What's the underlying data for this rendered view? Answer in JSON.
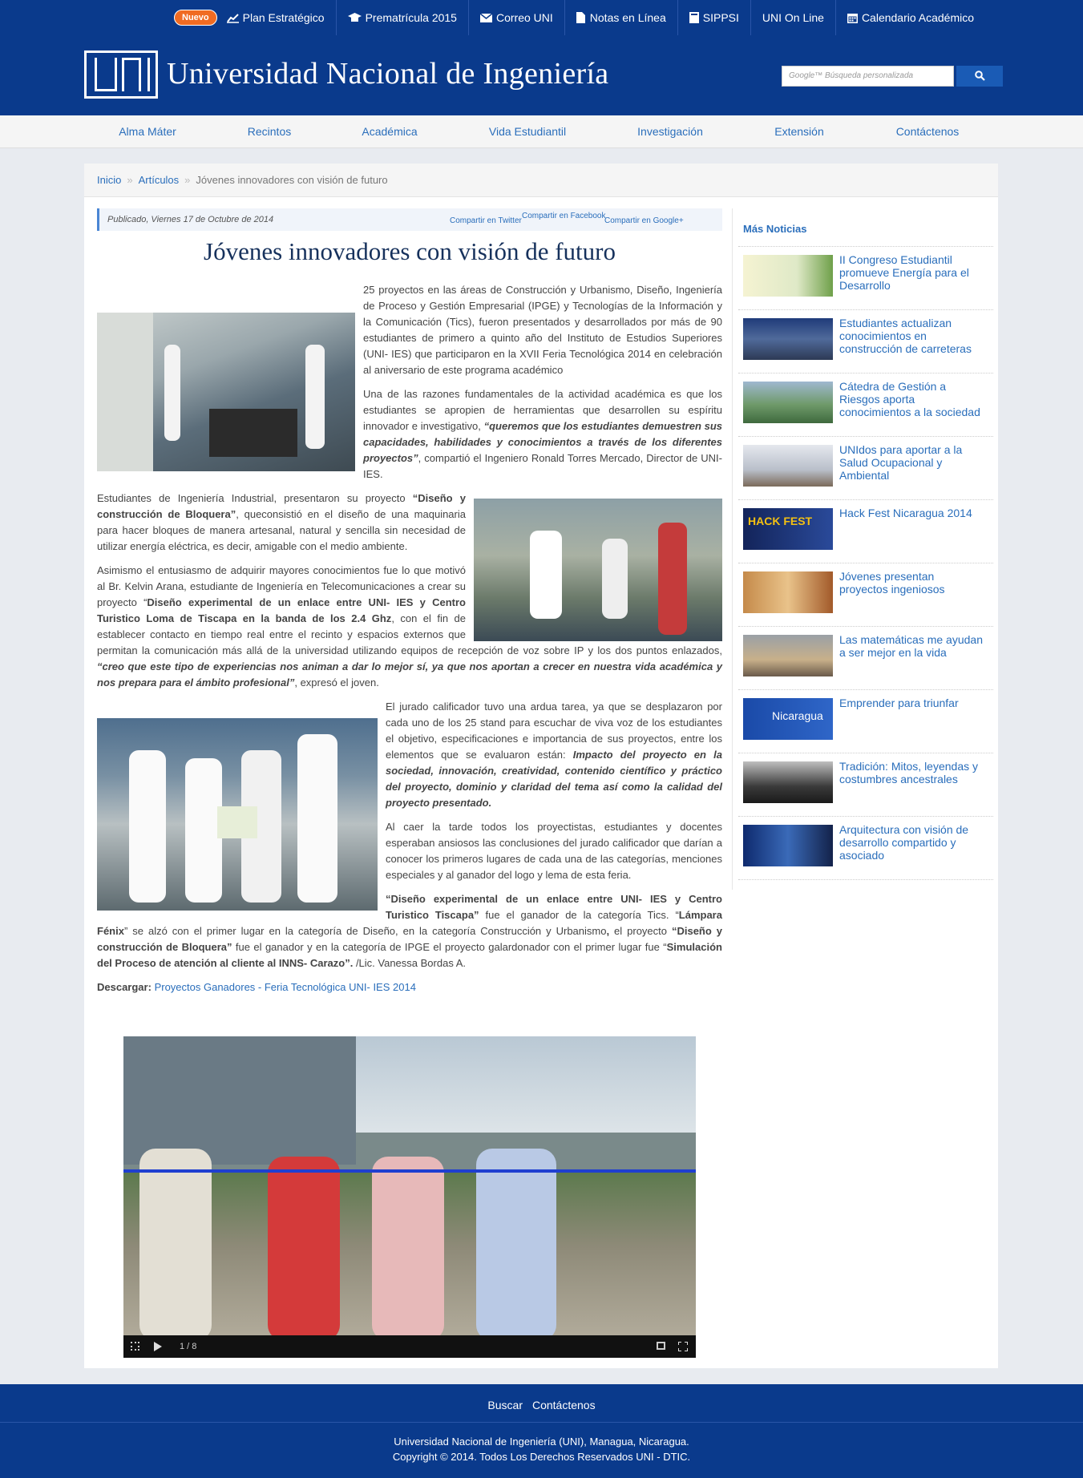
{
  "topbar": {
    "badge": "Nuevo",
    "links": [
      {
        "label": "Plan Estratégico",
        "icon": "chart-icon"
      },
      {
        "label": "Prematrícula 2015",
        "icon": "graduation-cap-icon"
      },
      {
        "label": "Correo UNI",
        "icon": "envelope-icon"
      },
      {
        "label": "Notas en Línea",
        "icon": "document-icon"
      },
      {
        "label": "SIPPSI",
        "icon": "book-icon"
      },
      {
        "label": "UNI On Line",
        "icon": ""
      },
      {
        "label": "Calendario Académico",
        "icon": "calendar-icon"
      }
    ]
  },
  "header": {
    "site_name": "Universidad Nacional de Ingeniería",
    "search_placeholder": "Google™ Búsqueda personalizada"
  },
  "nav": [
    "Alma Máter",
    "Recintos",
    "Académica",
    "Vida Estudiantil",
    "Investigación",
    "Extensión",
    "Contáctenos"
  ],
  "breadcrumb": {
    "home": "Inicio",
    "section": "Artículos",
    "current": "Jóvenes innovadores con visión de futuro"
  },
  "article": {
    "published": "Publicado, Viernes 17 de Octubre de 2014",
    "share_twitter": "Compartir en Twitter",
    "share_facebook": "Compartir en Facebook",
    "share_google": "Compartir en Google+",
    "title": "Jóvenes innovadores con visión de futuro",
    "p1": "25 proyectos en las áreas de Construcción y Urbanismo, Diseño, Ingeniería de Proceso y Gestión Empresarial (IPGE) y Tecnologías de la Información y la Comunicación (Tics), fueron presentados y desarrollados por más de 90 estudiantes de primero a quinto año del Instituto de Estudios Superiores (UNI- IES) que participaron en la XVII Feria Tecnológica 2014 en celebración al aniversario de este programa académico",
    "p2a": "Una de las razones fundamentales de la actividad académica es que los estudiantes se apropien de herramientas que desarrollen su espíritu innovador e investigativo, ",
    "p2b": "“queremos que los estudiantes demuestren sus capacidades, habilidades y conocimientos a través de los diferentes proyectos”",
    "p2c": ", compartió el Ingeniero Ronald Torres Mercado, Director de UNI- IES.",
    "p3a": "Estudiantes de Ingeniería Industrial, presentaron su proyecto ",
    "p3b": "“Diseño y construcción de Bloquera”",
    "p3c": ", queconsistió en el diseño de una maquinaria para hacer bloques de manera artesanal, natural y sencilla sin necesidad de utilizar energía eléctrica, es decir, amigable con el medio ambiente.",
    "p4a": "Asimismo el entusiasmo de adquirir mayores conocimientos fue lo que motivó al Br. Kelvin Arana, estudiante de Ingeniería en Telecomunicaciones a crear su proyecto “",
    "p4b": "Diseño experimental de un enlace entre UNI- IES y Centro Turistico Loma de Tiscapa en la banda de los 2.4 Ghz",
    "p4c": ", con el fin de establecer contacto en tiempo real entre el recinto y espacios externos que permitan la comunicación más allá de la universidad utilizando equipos de recepción de voz sobre IP y los dos puntos enlazados, ",
    "p4d": "“creo que este tipo de experiencias nos animan a dar lo mejor sí, ya que nos aportan a crecer en nuestra vida académica y nos prepara para el ámbito profesional”",
    "p4e": ", expresó el joven.",
    "p5a": "El jurado calificador tuvo una ardua tarea, ya que se desplazaron por cada uno de los 25 stand para escuchar de viva voz de los estudiantes el objetivo, especificaciones e importancia de sus proyectos, entre los elementos que se evaluaron están: ",
    "p5b": "Impacto del proyecto en la sociedad, innovación, creatividad, contenido científico y práctico del proyecto, dominio y claridad del tema así como la calidad del proyecto presentado.",
    "p6": "Al caer la tarde todos los proyectistas, estudiantes y docentes esperaban ansiosos las conclusiones del jurado calificador que darían a conocer los primeros lugares de cada una de las categorías, menciones especiales y al ganador del logo y lema de esta feria.",
    "p7a": "“Diseño experimental de un enlace entre UNI- IES y Centro Turistico Tiscapa”",
    "p7b": " fue el ganador de la categoría Tics. “",
    "p7c": "Lámpara Fénix",
    "p7d": "” se alzó con el primer lugar en la categoría de Diseño, en la categoría Construcción y Urbanismo",
    "p7e": ", ",
    "p7f": "el proyecto ",
    "p7g": "“Diseño y construcción de Bloquera”",
    "p7h": " fue el ganador y en la categoría de IPGE el proyecto galardonador con el primer lugar fue “",
    "p7i": "Simulación del Proceso de atención al cliente al  INNS- Carazo”.",
    "p7j": " /Lic. Vanessa Bordas A.",
    "download_label": "Descargar:",
    "download_link": "Proyectos Ganadores - Feria Tecnológica UNI- IES 2014",
    "slide_counter": "1 / 8"
  },
  "sidebar": {
    "heading": "Más Noticias",
    "items": [
      "II Congreso Estudiantil promueve Energía para el Desarrollo",
      "Estudiantes actualizan conocimientos en construcción de carreteras",
      "Cátedra de Gestión a Riesgos aporta conocimientos a la sociedad",
      "UNIdos para aportar a la Salud Ocupacional y Ambiental",
      "Hack Fest Nicaragua 2014",
      "Jóvenes presentan proyectos ingeniosos",
      "Las matemáticas me ayudan a ser mejor en la vida",
      "Emprender para triunfar",
      "Tradición: Mitos, leyendas y costumbres ancestrales",
      "Arquitectura con visión de desarrollo compartido y asociado"
    ],
    "thumb_texts": {
      "hackfest": "HACK FEST",
      "nicaragua": "Nicaragua"
    }
  },
  "footer": {
    "links": [
      "Buscar",
      "Contáctenos"
    ],
    "line1": "Universidad Nacional de Ingeniería (UNI), Managua, Nicaragua.",
    "line2": "Copyright © 2014. Todos Los Derechos Reservados UNI - DTIC."
  },
  "colors": {
    "brand": "#0a3a8c",
    "link": "#2a6ebb",
    "badge": "#f06b22"
  }
}
